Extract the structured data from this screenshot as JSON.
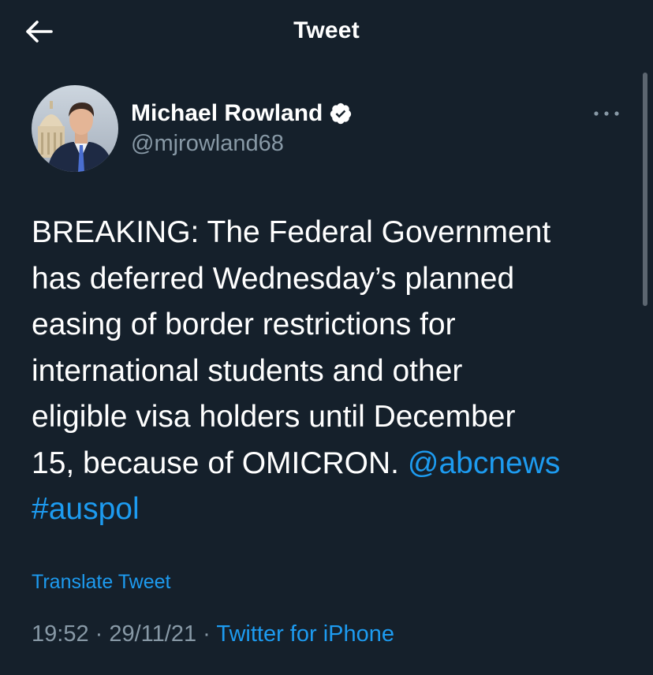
{
  "header": {
    "title": "Tweet",
    "back_icon": "arrow-left-icon"
  },
  "author": {
    "name": "Michael Rowland",
    "handle": "@mjrowland68",
    "verified_icon": "verified-badge-icon",
    "avatar_icon": "profile-photo"
  },
  "more_icon": "more-horizontal-icon",
  "tweet": {
    "line1": "BREAKING: The Federal Government",
    "line2": "has deferred Wednesday’s planned",
    "line3": "easing of border restrictions for",
    "line4": "international students and other",
    "line5": "eligible visa holders until December",
    "line6_text": "15, because of OMICRON. ",
    "line6_mention": "@abcnews",
    "line7_hashtag": "#auspol"
  },
  "translate_label": "Translate Tweet",
  "meta": {
    "time": "19:52",
    "separator1": " · ",
    "date": "29/11/21",
    "separator2": " · ",
    "source": "Twitter for iPhone"
  },
  "colors": {
    "background": "#15202b",
    "text_primary": "#ffffff",
    "text_secondary": "#8899a6",
    "link": "#1d9bf0",
    "verified_badge": "#ffffff"
  }
}
